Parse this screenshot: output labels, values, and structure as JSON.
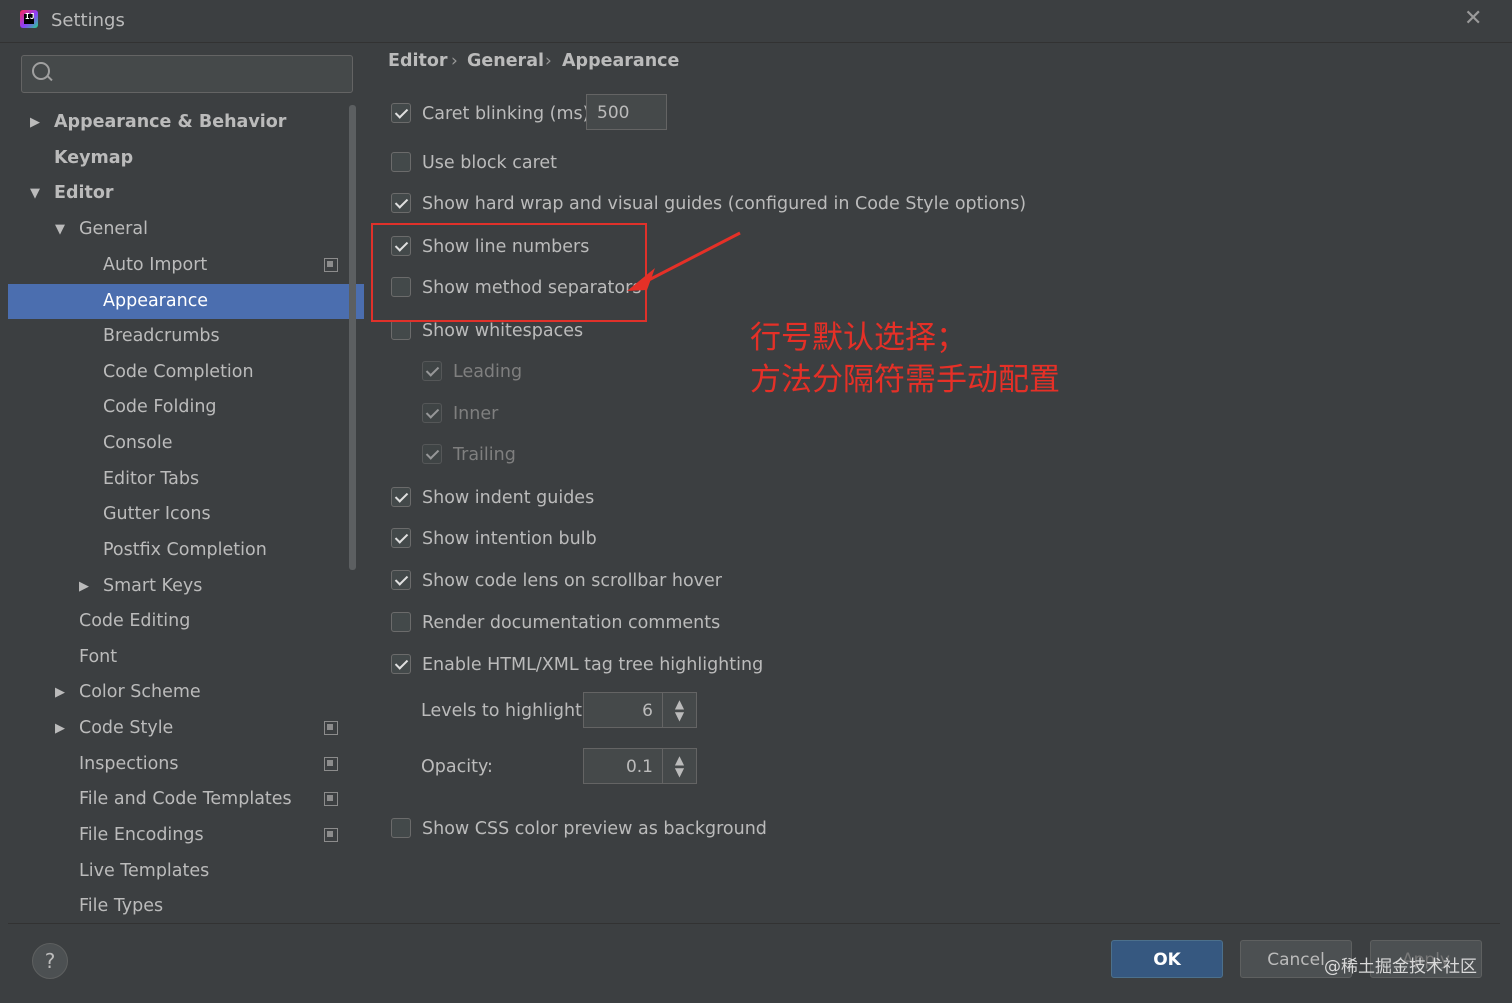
{
  "window": {
    "title": "Settings",
    "close": "✕"
  },
  "search": {
    "placeholder": "",
    "value": ""
  },
  "tree": {
    "appearance_behavior": "Appearance & Behavior",
    "keymap": "Keymap",
    "editor": "Editor",
    "general": "General",
    "auto_import": "Auto Import",
    "appearance": "Appearance",
    "breadcrumbs": "Breadcrumbs",
    "code_completion": "Code Completion",
    "code_folding": "Code Folding",
    "console": "Console",
    "editor_tabs": "Editor Tabs",
    "gutter_icons": "Gutter Icons",
    "postfix_completion": "Postfix Completion",
    "smart_keys": "Smart Keys",
    "code_editing": "Code Editing",
    "font": "Font",
    "color_scheme": "Color Scheme",
    "code_style": "Code Style",
    "inspections": "Inspections",
    "file_code_templates": "File and Code Templates",
    "file_encodings": "File Encodings",
    "live_templates": "Live Templates",
    "file_types": "File Types"
  },
  "breadcrumb": [
    "Editor",
    "General",
    "Appearance"
  ],
  "options": {
    "caret_blinking": {
      "label": "Caret blinking (ms):",
      "value": "500",
      "checked": true
    },
    "block_caret": {
      "label": "Use block caret",
      "checked": false
    },
    "hard_wrap": {
      "label": "Show hard wrap and visual guides (configured in Code Style options)",
      "checked": true
    },
    "line_numbers": {
      "label": "Show line numbers",
      "checked": true
    },
    "method_separators": {
      "label": "Show method separators",
      "checked": false
    },
    "whitespaces": {
      "label": "Show whitespaces",
      "checked": false
    },
    "leading": {
      "label": "Leading",
      "checked": true
    },
    "inner": {
      "label": "Inner",
      "checked": true
    },
    "trailing": {
      "label": "Trailing",
      "checked": true
    },
    "indent_guides": {
      "label": "Show indent guides",
      "checked": true
    },
    "intention_bulb": {
      "label": "Show intention bulb",
      "checked": true
    },
    "code_lens": {
      "label": "Show code lens on scrollbar hover",
      "checked": true
    },
    "render_docs": {
      "label": "Render documentation comments",
      "checked": false
    },
    "tag_tree": {
      "label": "Enable HTML/XML tag tree highlighting",
      "checked": true
    },
    "levels": {
      "label": "Levels to highlight:",
      "value": "6"
    },
    "opacity": {
      "label": "Opacity:",
      "value": "0.1"
    },
    "css_color": {
      "label": "Show CSS color preview as background",
      "checked": false
    }
  },
  "annotation": {
    "line1": "行号默认选择；",
    "line2": "方法分隔符需手动配置"
  },
  "footer": {
    "help": "?",
    "ok": "OK",
    "cancel": "Cancel",
    "apply": "Apply",
    "watermark": "@稀土掘金技术社区"
  },
  "colors": {
    "selection": "#4b6eaf",
    "background": "#3c3f41",
    "annotation": "#e53027",
    "ok_button": "#365880"
  }
}
